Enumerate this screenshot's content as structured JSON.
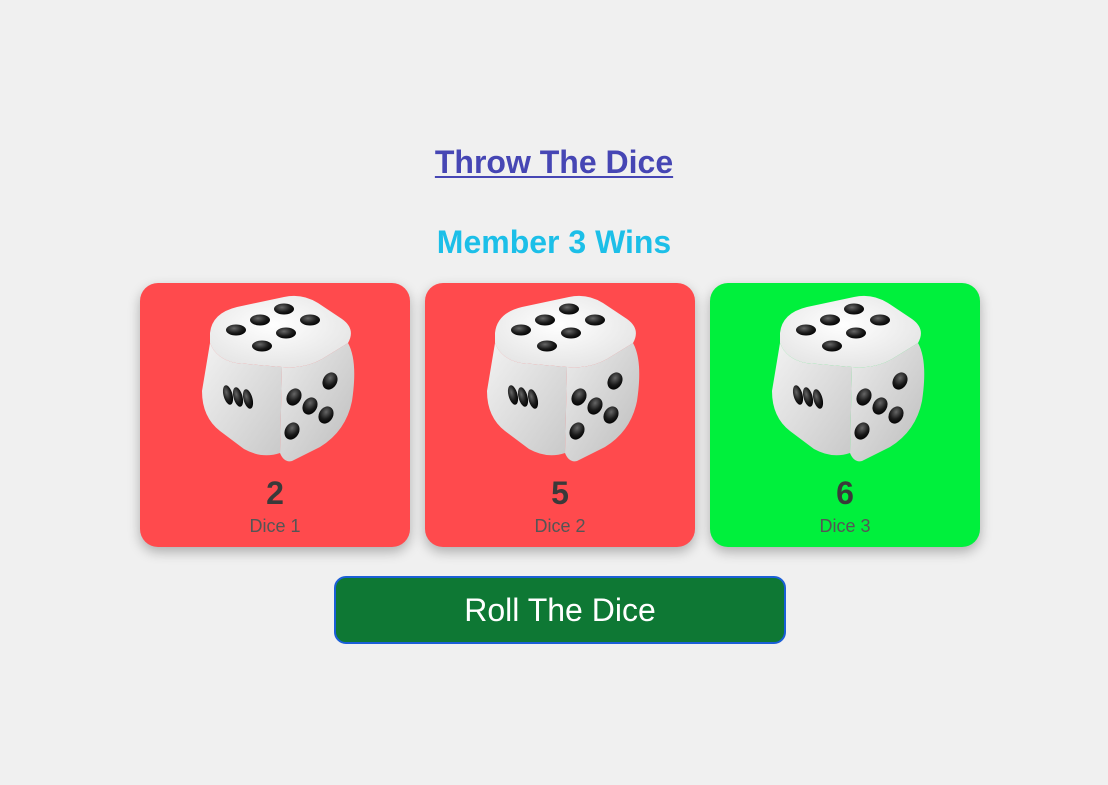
{
  "title": "Throw The Dice",
  "result": "Member 3 Wins",
  "dice": [
    {
      "value": "2",
      "label": "Dice 1",
      "color": "#ff4a4d",
      "status": "lose"
    },
    {
      "value": "5",
      "label": "Dice 2",
      "color": "#ff4a4d",
      "status": "lose"
    },
    {
      "value": "6",
      "label": "Dice 3",
      "color": "#00f03c",
      "status": "win"
    }
  ],
  "roll_button": "Roll The Dice",
  "colors": {
    "background": "#f0f0f0",
    "title_link": "#4646b4",
    "result_text": "#1cbfe8",
    "button_bg": "#0e7834",
    "button_border": "#1a5fd6"
  },
  "icons": [
    "dice-image"
  ]
}
